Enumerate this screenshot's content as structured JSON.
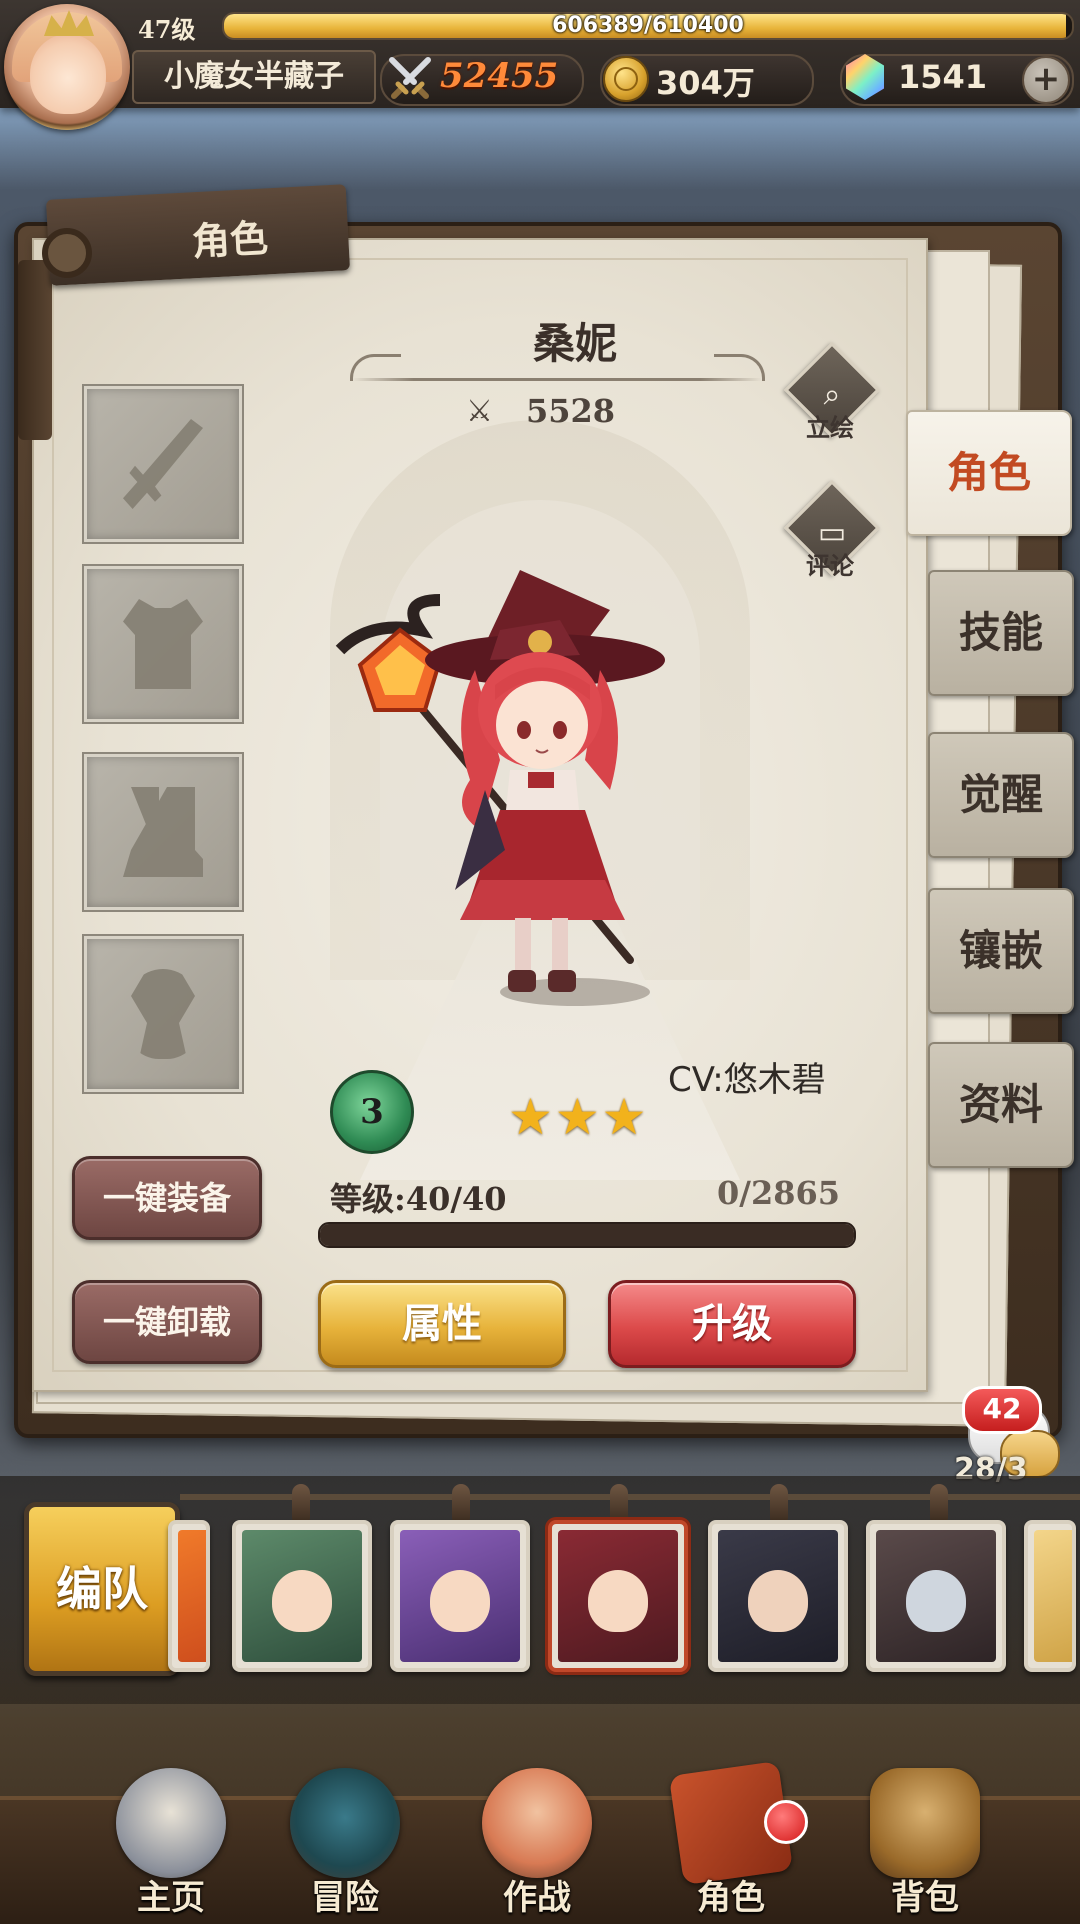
{
  "player": {
    "level": "47级",
    "exp": "606389/610400",
    "exp_fraction": 0.9934,
    "name": "小魔女半藏子"
  },
  "resources": {
    "power": "52455",
    "gold": "304万",
    "gems": "1541",
    "add_icon": "plus-icon"
  },
  "page": {
    "tag": "角色"
  },
  "equipment": [
    {
      "name": "weapon",
      "icon": "sword-icon"
    },
    {
      "name": "armor",
      "icon": "armor-icon"
    },
    {
      "name": "boots",
      "icon": "boots-icon"
    },
    {
      "name": "accessory",
      "icon": "amulet-icon"
    }
  ],
  "character": {
    "name": "桑妮",
    "power": "5528",
    "cv": "CV:悠木碧",
    "badge_number": "3",
    "stars": 3,
    "level_text": "等级:40/40",
    "exp_text": "0/2865",
    "level_fraction": 1.0
  },
  "side_actions": {
    "portrait": "立绘",
    "comment": "评论"
  },
  "tabs": [
    "角色",
    "技能",
    "觉醒",
    "镶嵌",
    "资料"
  ],
  "buttons": {
    "equip_all": "一键装备",
    "unequip_all": "一键卸载",
    "attributes": "属性",
    "upgrade": "升级"
  },
  "chat": {
    "badge": "42",
    "roster_count": "28/3"
  },
  "roster": {
    "team_button": "编队"
  },
  "nav": [
    "主页",
    "冒险",
    "作战",
    "角色",
    "背包"
  ],
  "colors": {
    "accent_red": "#c24a22",
    "gold_button": "#e7b33b",
    "red_button": "#dc4a4a",
    "power_orange": "#ff8a3a"
  }
}
